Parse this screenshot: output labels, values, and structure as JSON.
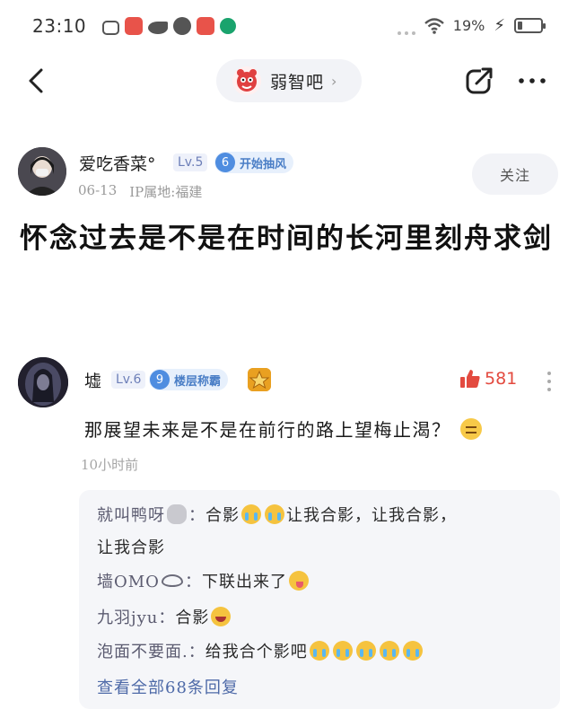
{
  "status": {
    "time": "23:10",
    "battery_percent": "19%",
    "battery_level": 0.19
  },
  "nav": {
    "forum_name": "弱智吧",
    "chevron": "›"
  },
  "post": {
    "author": {
      "name": "爱吃香菜°",
      "level": "Lv.5",
      "title_level": "6",
      "title": "开始抽风"
    },
    "date": "06-13",
    "ip_location": "IP属地:福建",
    "follow_label": "关注",
    "title": "怀念过去是不是在时间的长河里刻舟求剑"
  },
  "comment": {
    "user": {
      "name": "墟",
      "level": "Lv.6",
      "title_level": "9",
      "title": "楼层称霸"
    },
    "likes": "581",
    "text": "那展望未来是不是在前行的路上望梅止渴？",
    "time": "10小时前",
    "replies": [
      {
        "user": "就叫鸭呀",
        "sep": "：",
        "text_1": "合影",
        "text_2": "让我合影，让我合影，",
        "text_3": "让我合影"
      },
      {
        "user": "墙OMO",
        "sep": "：",
        "text": "下联出来了"
      },
      {
        "user": "九羽jyu",
        "sep": "：",
        "text": "合影"
      },
      {
        "user": "泡面不要面.",
        "sep": "：",
        "text": "给我合个影吧"
      }
    ],
    "view_all": "查看全部68条回复"
  },
  "colors": {
    "accent_red": "#e34a3f",
    "badge_blue": "#4f8de0",
    "link_blue": "#4e6aa8"
  }
}
